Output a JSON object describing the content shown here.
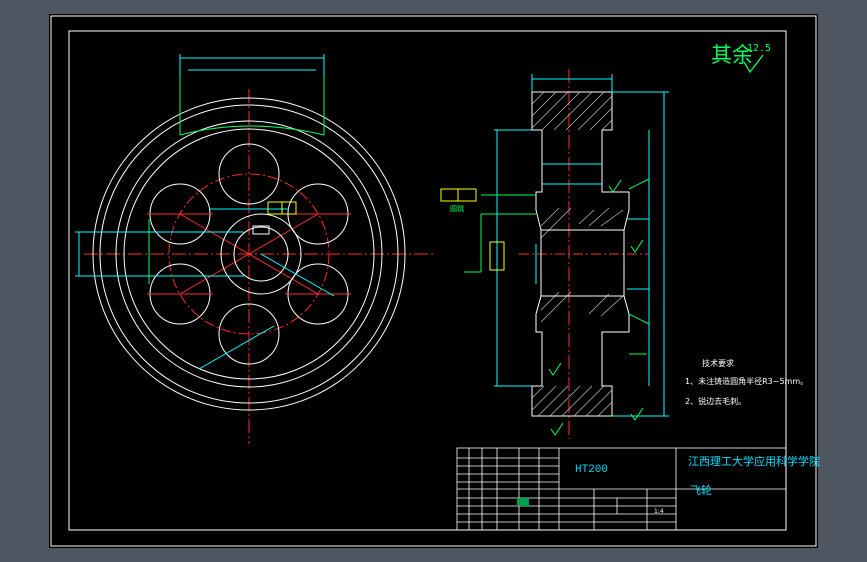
{
  "surface_roughness": {
    "symbol": "其余",
    "value": "12.5"
  },
  "tech_requirements": {
    "title": "技术要求",
    "items": [
      "1、未注铸造圆角半径R3~5mm。",
      "2、锐边去毛刺。"
    ]
  },
  "title_block": {
    "material": "HT200",
    "school": "江西理工大学应用科学学院",
    "part_name": "飞轮",
    "scale": "1:4"
  },
  "annotations": {
    "datum_label": "圆跳"
  },
  "colors": {
    "background": "#000000",
    "outline": "#ffffff",
    "centerline": "#ff2a2a",
    "dimension": "#00ffff",
    "callout": "#00ff5a",
    "hatch": "#c0c0c0"
  }
}
